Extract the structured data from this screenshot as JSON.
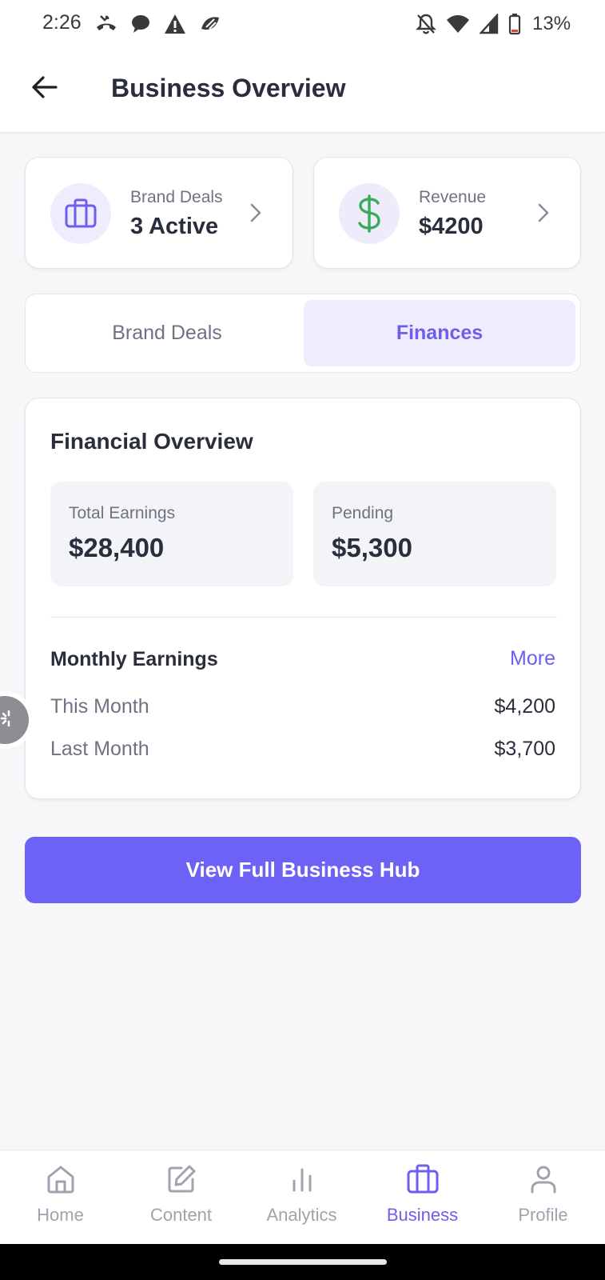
{
  "status_bar": {
    "time": "2:26",
    "battery": "13%",
    "left_icons": [
      "missed-call-icon",
      "chat-bubble-icon",
      "warning-icon",
      "app-notification-icon"
    ],
    "right_icons": [
      "notifications-off-icon",
      "wifi-icon",
      "signal-icon",
      "battery-low-icon"
    ]
  },
  "app_bar": {
    "title": "Business Overview",
    "back_icon": "arrow-left-icon"
  },
  "summary": {
    "brand_deals": {
      "label": "Brand Deals",
      "value": "3 Active",
      "icon": "briefcase-icon"
    },
    "revenue": {
      "label": "Revenue",
      "value": "$4200",
      "icon": "dollar-icon"
    }
  },
  "tabs": [
    {
      "label": "Brand Deals",
      "active": false
    },
    {
      "label": "Finances",
      "active": true
    }
  ],
  "financial": {
    "title": "Financial Overview",
    "total_earnings": {
      "label": "Total Earnings",
      "value": "$28,400"
    },
    "pending": {
      "label": "Pending",
      "value": "$5,300"
    },
    "monthly": {
      "title": "Monthly Earnings",
      "more": "More",
      "rows": [
        {
          "label": "This Month",
          "value": "$4,200"
        },
        {
          "label": "Last Month",
          "value": "$3,700"
        }
      ]
    }
  },
  "cta": {
    "label": "View Full Business Hub"
  },
  "bottom_nav": [
    {
      "label": "Home",
      "icon": "home-icon",
      "active": false
    },
    {
      "label": "Content",
      "icon": "edit-icon",
      "active": false
    },
    {
      "label": "Analytics",
      "icon": "bar-chart-icon",
      "active": false
    },
    {
      "label": "Business",
      "icon": "briefcase-icon",
      "active": true
    },
    {
      "label": "Profile",
      "icon": "user-icon",
      "active": false
    }
  ],
  "colors": {
    "accent": "#6c5ff0",
    "cta": "#6c63f6",
    "revenue_icon": "#3daa5a",
    "tab_active_bg": "#efecfd",
    "icon_bg_purple": "#efecfd",
    "icon_bg_green": "#eeecfb"
  }
}
